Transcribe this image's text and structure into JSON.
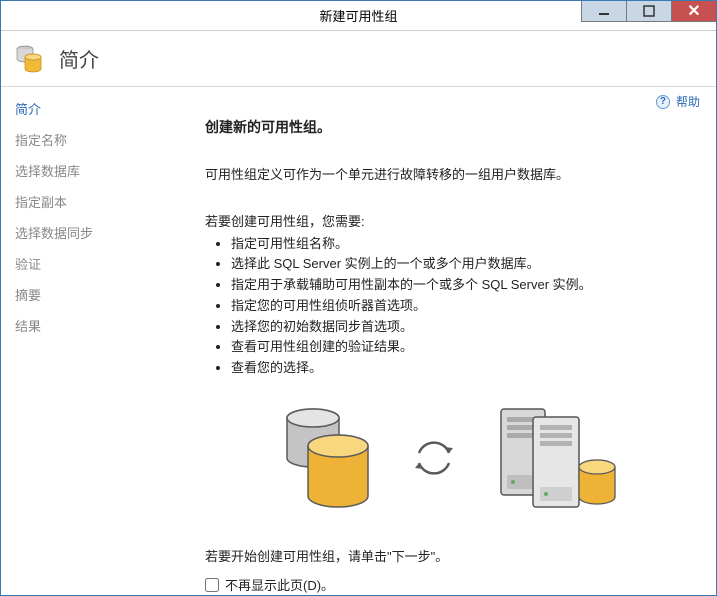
{
  "window": {
    "title": "新建可用性组"
  },
  "header": {
    "title": "简介"
  },
  "sidebar": {
    "items": [
      {
        "label": "简介",
        "active": true
      },
      {
        "label": "指定名称",
        "active": false
      },
      {
        "label": "选择数据库",
        "active": false
      },
      {
        "label": "指定副本",
        "active": false
      },
      {
        "label": "选择数据同步",
        "active": false
      },
      {
        "label": "验证",
        "active": false
      },
      {
        "label": "摘要",
        "active": false
      },
      {
        "label": "结果",
        "active": false
      }
    ]
  },
  "help": {
    "label": "帮助"
  },
  "content": {
    "heading": "创建新的可用性组。",
    "description": "可用性组定义可作为一个单元进行故障转移的一组用户数据库。",
    "lead": "若要创建可用性组，您需要:",
    "bullets": [
      "指定可用性组名称。",
      "选择此 SQL Server 实例上的一个或多个用户数据库。",
      "指定用于承载辅助可用性副本的一个或多个 SQL Server 实例。",
      "指定您的可用性组侦听器首选项。",
      "选择您的初始数据同步首选项。",
      "查看可用性组创建的验证结果。",
      "查看您的选择。"
    ],
    "footer_text": "若要开始创建可用性组，请单击\"下一步\"。",
    "checkbox_label": "不再显示此页(D)。"
  }
}
